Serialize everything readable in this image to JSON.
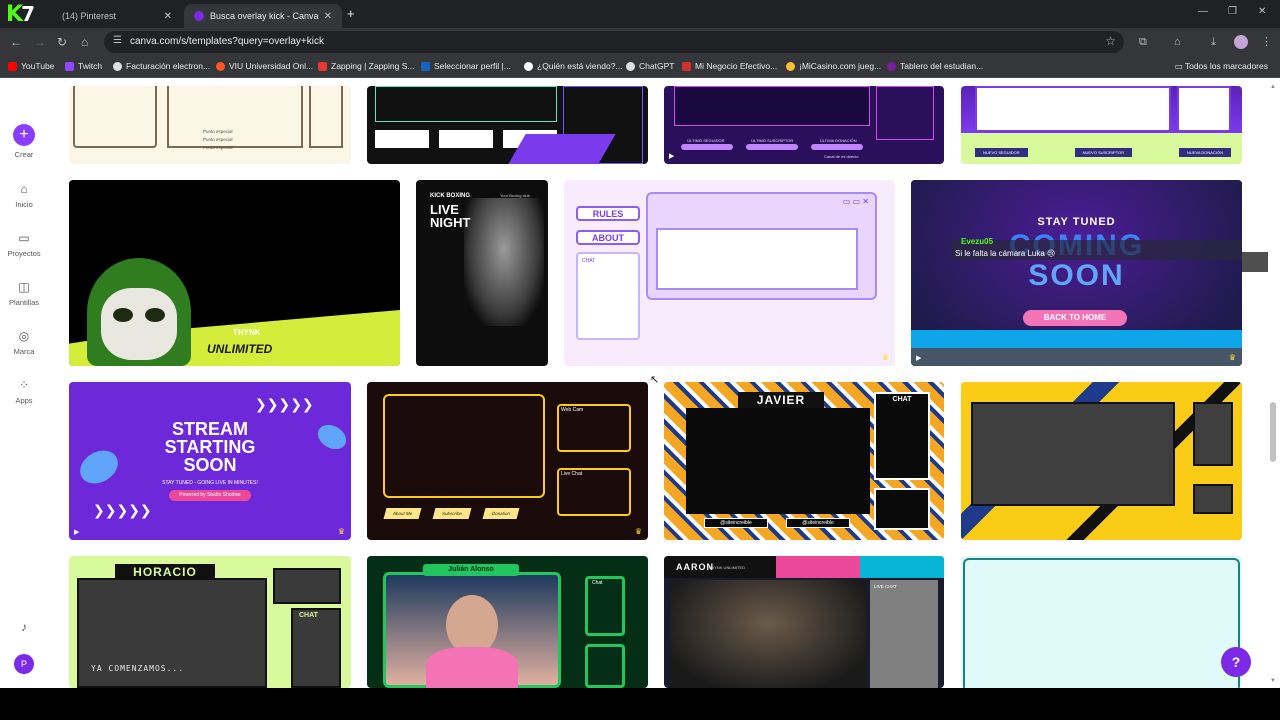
{
  "browser": {
    "tabs": [
      {
        "label": "(14) Pinterest"
      },
      {
        "label": "Busca overlay kick - Canva"
      }
    ],
    "url": "canva.com/s/templates?query=overlay+kick",
    "bookmarks": [
      {
        "label": "YouTube",
        "color": "#ff0000"
      },
      {
        "label": "Twitch",
        "color": "#9146ff"
      },
      {
        "label": "Facturación electron...",
        "color": "#e0e0e0"
      },
      {
        "label": "VIU Universidad Onl...",
        "color": "#ff5722"
      },
      {
        "label": "Zapping | Zapping S...",
        "color": "#e53935"
      },
      {
        "label": "Seleccionar perfil |...",
        "color": "#1565c0"
      },
      {
        "label": "¿Quién está viendo?...",
        "color": "#ffffff"
      },
      {
        "label": "ChatGPT",
        "color": "#e0e0e0"
      },
      {
        "label": "Mi Negocio Efectivo...",
        "color": "#d32f2f"
      },
      {
        "label": "¡MiCasino.com jueg...",
        "color": "#fbc02d"
      },
      {
        "label": "Tablero del estudian...",
        "color": "#7b1fa2"
      }
    ],
    "bookmarks_all": "Todos los marcadores"
  },
  "sidebar": {
    "items": [
      {
        "label": "Crear"
      },
      {
        "label": "Inicio"
      },
      {
        "label": "Proyectos"
      },
      {
        "label": "Plantillas"
      },
      {
        "label": "Marca"
      },
      {
        "label": "Apps"
      }
    ],
    "avatar_initial": "P"
  },
  "cards": {
    "row1": {
      "card1": {
        "labels": [
          "Punto especial",
          "Punto especial",
          "Punto especial"
        ]
      },
      "card3": {
        "labels": [
          "ÚLTIMO SEGUIDOR",
          "ÚLTIMO SUSCRIPTOR",
          "ÚLTIMA DONACIÓN"
        ],
        "footer": "Canal de mi directo"
      },
      "card4": {
        "labels": [
          "NUEVO SEGUIDOR",
          "NUEVO SUSCRIPTOR",
          "NUEVA DONACIÓN"
        ]
      }
    },
    "thynk": {
      "name": "THYNK",
      "sub": "UNLIMITED"
    },
    "boxing": {
      "top": "KICK BOXING",
      "title1": "LIVE",
      "title2": "NIGHT",
      "club": "Your Boxing club"
    },
    "cute": {
      "rules": "RULES",
      "about": "ABOUT",
      "chat": "CHAT"
    },
    "coming": {
      "stay": "STAY TUNED",
      "line1": "COMING",
      "line2": "SOON",
      "back": "BACK TO HOME",
      "chat_user": "Evezu05",
      "chat_msg": "Si le falta la cámara Luka 😢"
    },
    "stream": {
      "line1": "STREAM",
      "line2": "STARTING",
      "line3": "SOON",
      "sub": "STAY TUNED - GOING LIVE IN MINUTES!",
      "powered": "Powered by Studio Shodwe"
    },
    "gold": {
      "webcam": "Web Cam",
      "livechat": "Live Chat",
      "tabs": [
        "About Me",
        "Subscribe",
        "Donation"
      ]
    },
    "javier": {
      "name": "JAVIER",
      "chat": "CHAT",
      "handles": [
        "@siteincreible",
        "@siteincreible"
      ]
    },
    "horacio": {
      "name": "HORACIO",
      "chat": "CHAT",
      "message": "YA COMENZAMOS..."
    },
    "julian": {
      "name": "Julián Alonso",
      "chat": "Chat"
    },
    "aaron": {
      "name": "AARON",
      "sub": "TWYNK UNLIMITED",
      "livechat": "LIVE CHAT"
    }
  },
  "colors": {
    "canva_purple": "#8b3dff",
    "kick_green": "#53fc18"
  }
}
